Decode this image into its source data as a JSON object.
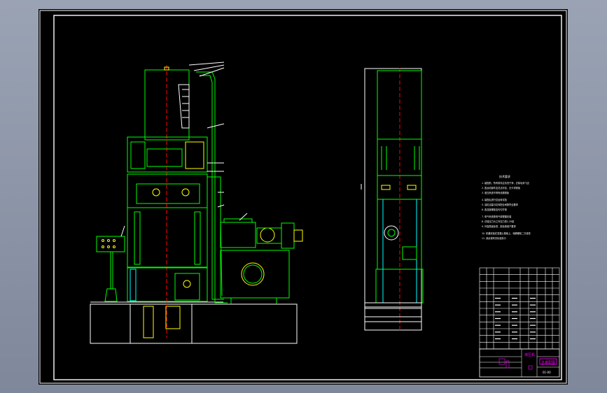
{
  "drawing": {
    "notes_heading": "技术要求",
    "notes_lines": [
      "1. 装配前，所有零件应清洗干净，去除毛刺飞边",
      "2. 各运动部件应灵活可靠，无卡滞现象",
      "3. 液压系统不得有渗漏现象",
      "4. 装配后进行空运转试验",
      "5. 油缸活塞与缸体配合间隙符合要求",
      "6. 各连接螺栓应均匀拧紧",
      "7. 电气系统按电气原理图安装",
      "8. 试验压力为工作压力的1.25倍",
      "9. 外露表面涂漆，颜色按用户要求",
      "10. 机器安装在混凝土基础上，地脚螺栓二次灌浆",
      "11. 其余按有关标准执行"
    ],
    "title_block": {
      "title_magenta": "液压机",
      "drawing_name": "总装配图",
      "drawing_no": "01-00"
    },
    "bom_rows": 11,
    "colors": {
      "background": "#000000",
      "frame": "#ffffff",
      "outline": "#00ff00",
      "centerline": "#ff0000",
      "dimension": "#ffffff",
      "cyan": "#00ffff",
      "magenta": "#ff00ff",
      "yellow": "#ffff00"
    }
  }
}
